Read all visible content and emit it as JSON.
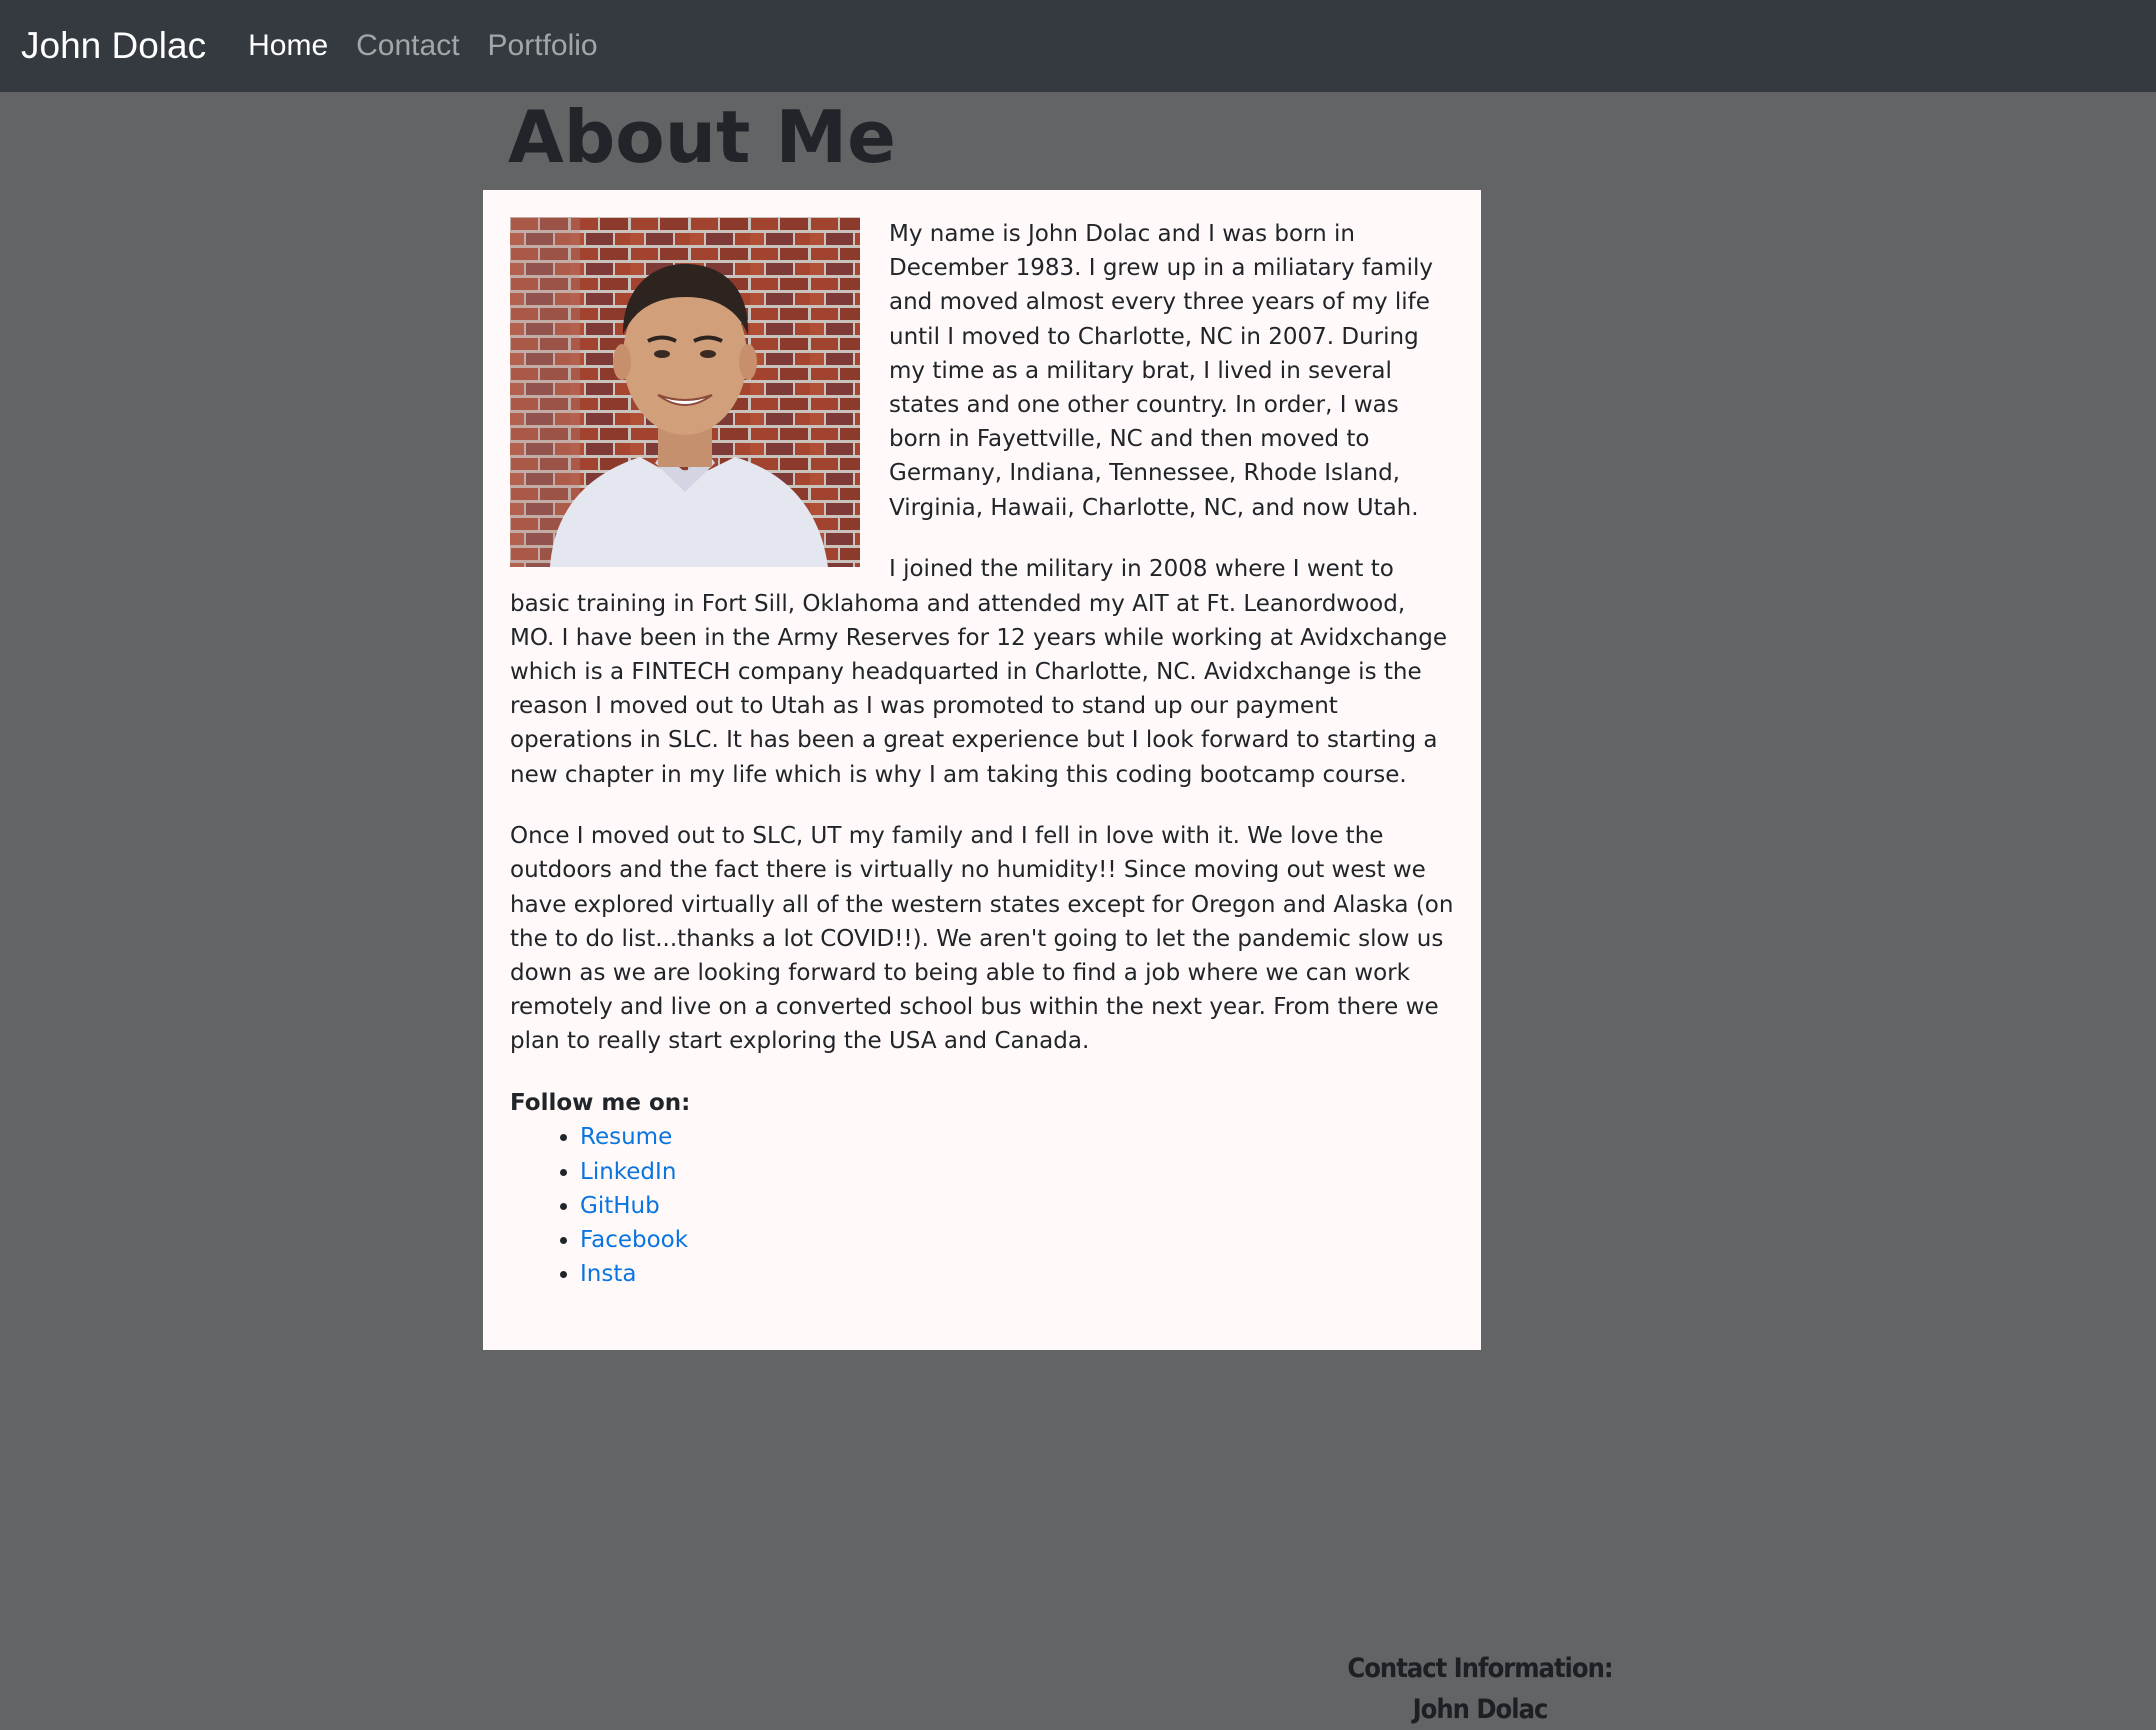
{
  "navbar": {
    "brand": "John Dolac",
    "links": [
      "Home",
      "Contact",
      "Portfolio"
    ]
  },
  "main": {
    "title": "About Me",
    "paragraphs": [
      "My name is John Dolac and I was born in December 1983. I grew up in a miliatary family and moved almost every three years of my life until I moved to Charlotte, NC in 2007. During my time as a military brat, I lived in several states and one other country. In order, I was born in Fayettville, NC and then moved to Germany, Indiana, Tennessee, Rhode Island, Virginia, Hawaii, Charlotte, NC, and now Utah.",
      "I joined the military in 2008 where I went to basic training in Fort Sill, Oklahoma and attended my AIT at Ft. Leanordwood, MO. I have been in the Army Reserves for 12 years while working at Avidxchange which is a FINTECH company headquarted in Charlotte, NC. Avidxchange is the reason I moved out to Utah as I was promoted to stand up our payment operations in SLC. It has been a great experience but I look forward to starting a new chapter in my life which is why I am taking this coding bootcamp course.",
      "Once I moved out to SLC, UT my family and I fell in love with it. We love the outdoors and the fact there is virtually no humidity!! Since moving out west we have explored virtually all of the western states except for Oregon and Alaska (on the to do list...thanks a lot COVID!!). We aren't going to let the pandemic slow us down as we are looking forward to being able to find a job where we can work remotely and live on a converted school bus within the next year. From there we plan to really start exploring the USA and Canada."
    ],
    "follow_label": "Follow me on:",
    "follow_links": [
      "Resume",
      "LinkedIn",
      "GitHub",
      "Facebook",
      "Insta"
    ]
  },
  "footer": {
    "heading": "Contact Information:",
    "name": "John Dolac"
  },
  "colors": {
    "navbar_bg": "#343a40",
    "page_bg": "#636466",
    "card_bg": "#fffaf9",
    "link": "#0a74e0"
  }
}
